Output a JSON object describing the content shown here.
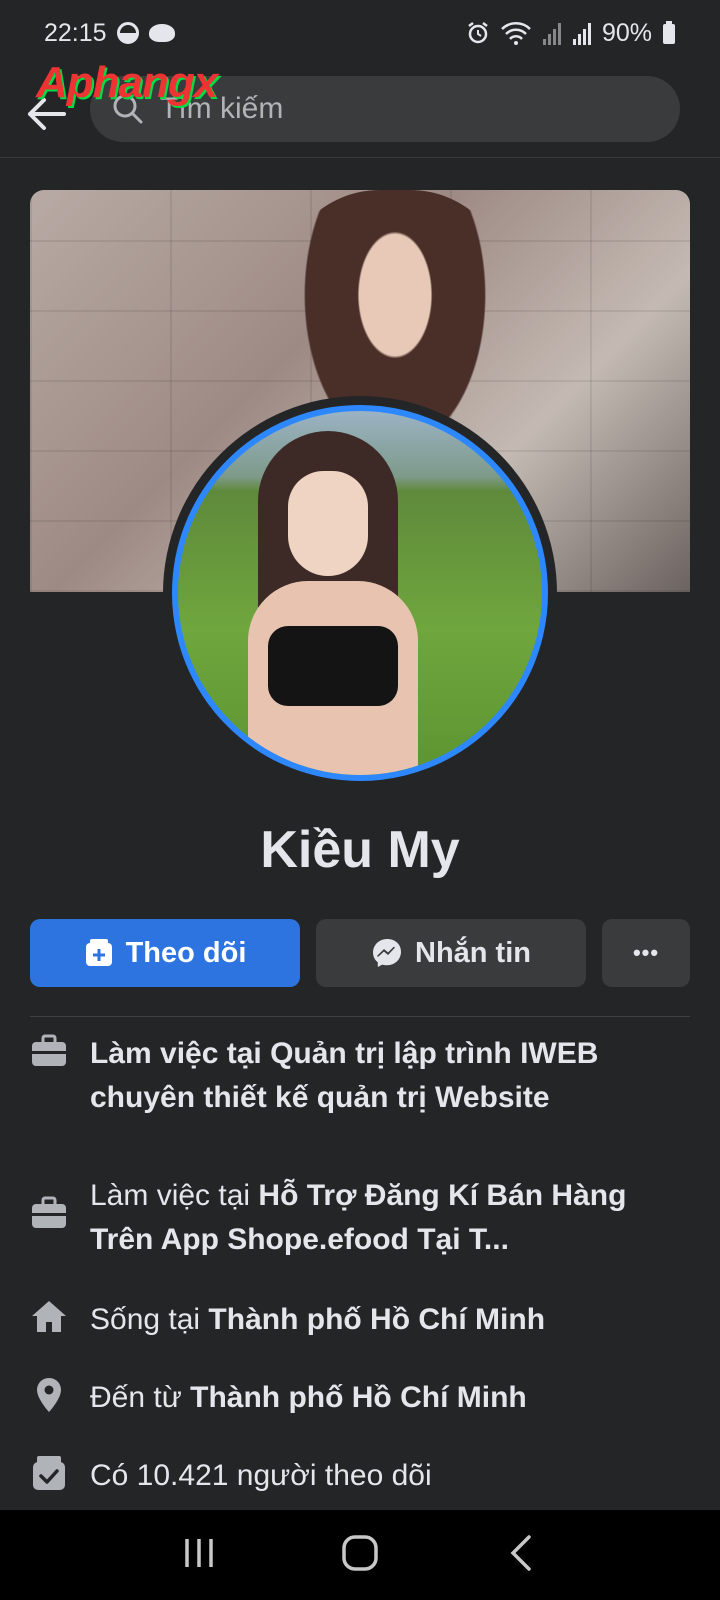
{
  "status_bar": {
    "time": "22:15",
    "battery": "90%"
  },
  "top_bar": {
    "search_placeholder": "Tìm kiếm",
    "watermark": "Aphangx"
  },
  "profile": {
    "name": "Kiều My"
  },
  "actions": {
    "follow_label": "Theo dõi",
    "message_label": "Nhắn tin",
    "more_label": "•••"
  },
  "info": {
    "work1_prefix": "",
    "work1_value": "Làm việc tại Quản trị lập trình IWEB chuyên thiết kế quản trị Website",
    "work2_prefix": "Làm việc tại ",
    "work2_value": "Hỗ Trợ Đăng Kí Bán Hàng Trên App Shope.efood Tại T...",
    "lives_prefix": "Sống tại ",
    "lives_value": "Thành phố Hồ Chí Minh",
    "from_prefix": "Đến từ ",
    "from_value": "Thành phố Hồ Chí Minh",
    "followers_text": "Có 10.421 người theo dõi"
  },
  "colors": {
    "accent": "#2d74e0",
    "ring": "#2d88ff",
    "background": "#242526"
  }
}
